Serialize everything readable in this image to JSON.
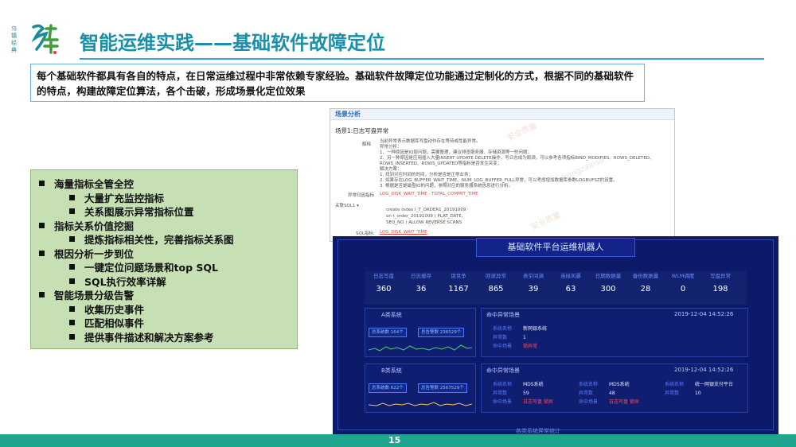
{
  "logo": {
    "vertical_text": "乌镇经典",
    "mark_alt": "logo"
  },
  "title": "智能运维实践——基础软件故障定位",
  "intro": "每个基础软件都具有各自的特点，在日常运维过程中非常依赖专家经验。基础软件故障定位功能通过定制化的方式，根据不同的基础软件的特点，构建故障定位算法，各个击破，形成场景化定位效果",
  "bullets": [
    {
      "level": 1,
      "text": "海量指标全管全控"
    },
    {
      "level": 2,
      "text": "大量扩充监控指标"
    },
    {
      "level": 2,
      "text": "关系图展示异常指标位置"
    },
    {
      "level": 1,
      "text": "指标关系价值挖掘"
    },
    {
      "level": 2,
      "text": "提炼指标相关性，完善指标关系图"
    },
    {
      "level": 1,
      "text": "根因分析一步到位"
    },
    {
      "level": 2,
      "text": "一键定位问题场景和top SQL"
    },
    {
      "level": 2,
      "text": "SQL执行效率详解"
    },
    {
      "level": 1,
      "text": "智能场景分级告警"
    },
    {
      "level": 2,
      "text": "收集历史事件"
    },
    {
      "level": 2,
      "text": "匹配相似事件"
    },
    {
      "level": 2,
      "text": "提供事件描述和解决方案参考"
    }
  ],
  "analysis": {
    "header": "场景分析",
    "scene": "场景1:日志写盘异常",
    "explain_label": "解释",
    "explain_lines": [
      "当前异常表示数据库写盘动作存在等待或性能异常。",
      "异常分析：",
      "1、一种原因是IO层问题，需要整理，建议排查服务器、存储资源等一些问题；",
      "2、另一种原因是应用插入大量INSERT UPDATE DELETE操作，写日志成为瓶颈，可以参考各项指标BIND_MODIFIES、ROWS_DELETED、",
      "ROWS_INSERTED、ROWS_UPDATED等指标是否发生突变；",
      "解决方案：",
      "1. 找到对应时间的时间，分析是否是正常业务；",
      "2. 如果存在LOG_BUFFER_WAIT_TIME、NUM_LOG_BUFFER_FULL异常，可以考虑增加数据库参数LOGBUFSZ的设置。",
      "3. 根据是否是磁盘IO的问题，参照对应的服务器系统信息进行分析。"
    ],
    "metric_label": "异常归因指标",
    "metric_value": "LOG_DISK_WAIT_TIME · TOTAL_COMMIT_TIME",
    "sql_label": "关联SQL1 ▾",
    "sql_lines": [
      "create  index  I_T_ORDER1_20191009",
      "   on t_order_20191009 (  PLAT_DATE,",
      "   SEQ_NO ) ALLOW REVERSE SCANS"
    ],
    "sql_metric_label": "SQL指标:",
    "sql_metric_value": "LOG_DISK_WAIT_TIME",
    "watermarks": [
      "安全质量",
      "kongzainsa",
      "安全质量",
      "kongzainsa"
    ]
  },
  "dashboard": {
    "title": "基础软件平台运维机器人",
    "metrics": [
      {
        "label": "日志写盘",
        "value": "360"
      },
      {
        "label": "日志缓存",
        "value": "36"
      },
      {
        "label": "锁竞争",
        "value": "1167"
      },
      {
        "label": "回滚异常",
        "value": "865"
      },
      {
        "label": "表空间满",
        "value": "39"
      },
      {
        "label": "连接风暴",
        "value": "63"
      },
      {
        "label": "日期数据量",
        "value": "300"
      },
      {
        "label": "备份数据量",
        "value": "28"
      },
      {
        "label": "WLM调度",
        "value": "0"
      },
      {
        "label": "写盘异常",
        "value": "198"
      }
    ],
    "panelA": {
      "title": "A类系统",
      "chip1": "总系统数 164个",
      "chip2": "总告警数 236529个"
    },
    "panelB": {
      "title": "B类系统",
      "chip1": "总系统数 622个",
      "chip2": "总告警数 2567529个"
    },
    "sceneA": {
      "title": "命中异常场景",
      "timestamp": "2019-12-04 14:52:26",
      "rows": [
        {
          "k": "系统名称",
          "v": "新网银系统"
        },
        {
          "k": "异常数",
          "v": "1"
        },
        {
          "k": "命中场景",
          "v": "锁异常",
          "red": true
        }
      ]
    },
    "sceneB": {
      "title": "命中异常场景",
      "timestamp": "2019-12-04 14:52:26",
      "cols": [
        {
          "rows": [
            {
              "k": "系统名称",
              "v": "MDS系统"
            },
            {
              "k": "异常数",
              "v": "59"
            },
            {
              "k": "命中场景",
              "v": "日志写盘 锁异",
              "red": true
            }
          ]
        },
        {
          "rows": [
            {
              "k": "系统名称",
              "v": "MDS系统"
            },
            {
              "k": "异常数",
              "v": "48"
            },
            {
              "k": "命中场景",
              "v": "日志写盘 锁异",
              "red": true
            }
          ]
        },
        {
          "rows": [
            {
              "k": "系统名称",
              "v": "统一网银支付平台"
            },
            {
              "k": "异常数",
              "v": "10"
            }
          ]
        }
      ]
    },
    "bottom_label": "各类系统异常统计"
  },
  "footer": {
    "page": "15"
  },
  "colors": {
    "title": "#1a8fa7",
    "footer": "#20a58f",
    "bulletbox": "#c6e0b4",
    "dashboard": "#0d1a6a"
  }
}
